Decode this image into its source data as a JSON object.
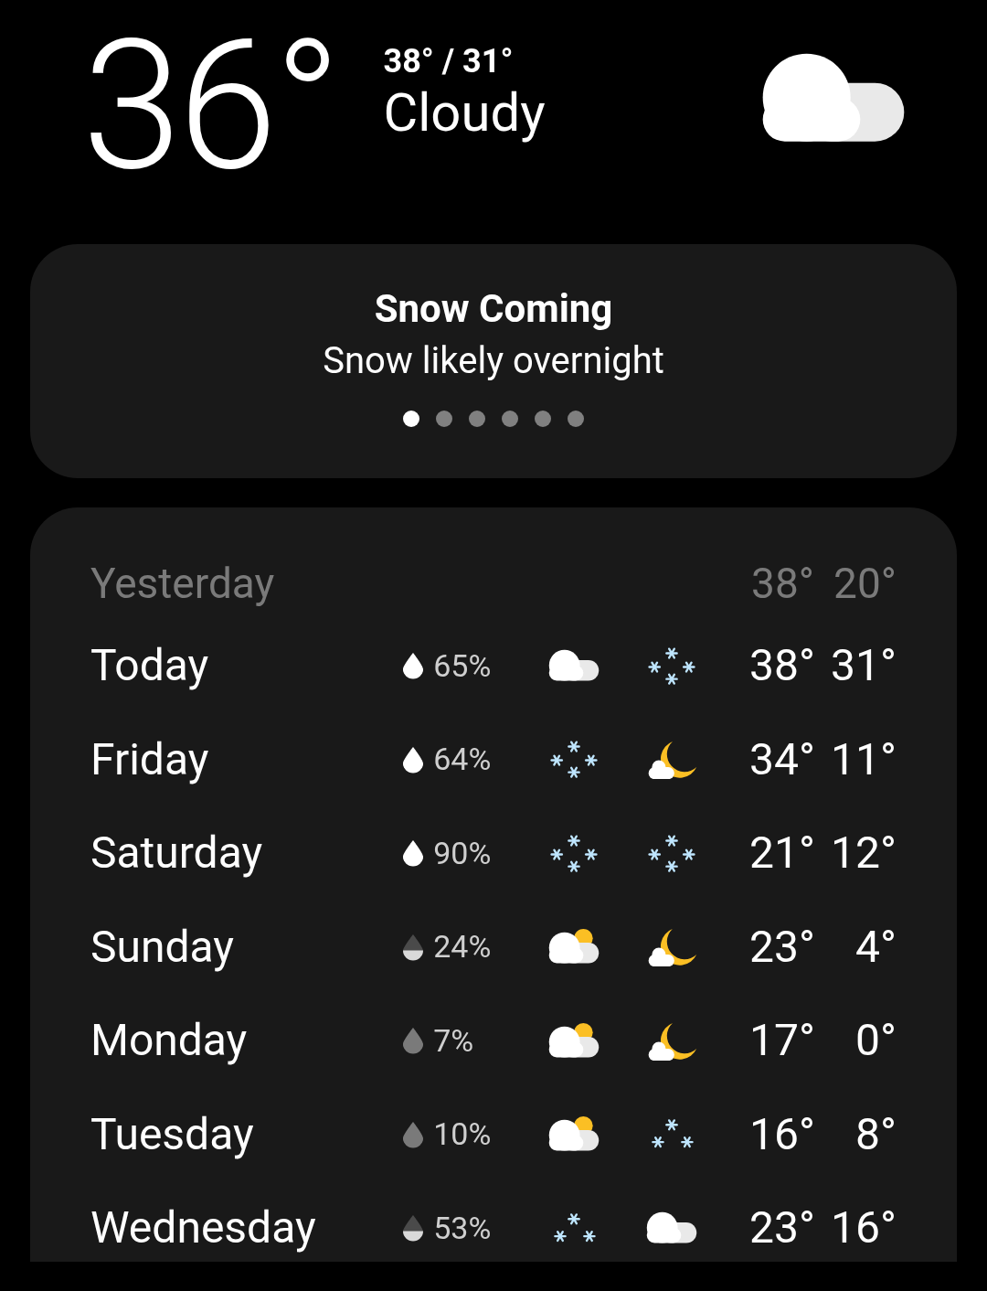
{
  "current": {
    "temperature": "36°",
    "high_low": "38° / 31°",
    "condition": "Cloudy",
    "icon": {
      "kind": "cloudy"
    }
  },
  "alert": {
    "title": "Snow Coming",
    "message": "Snow likely overnight",
    "pages": [
      {
        "selected": true
      },
      {
        "selected": false
      },
      {
        "selected": false
      },
      {
        "selected": false
      },
      {
        "selected": false
      },
      {
        "selected": false
      }
    ]
  },
  "yesterday": {
    "label": "Yesterday",
    "high": "38°",
    "low": "20°"
  },
  "forecast": [
    {
      "day": "Today",
      "drop": {
        "kind": "full"
      },
      "chance": "65%",
      "day_icon": {
        "kind": "cloudy"
      },
      "night_icon": {
        "kind": "snow"
      },
      "high": "38°",
      "low": "31°"
    },
    {
      "day": "Friday",
      "drop": {
        "kind": "full"
      },
      "chance": "64%",
      "day_icon": {
        "kind": "snow"
      },
      "night_icon": {
        "kind": "moon"
      },
      "high": "34°",
      "low": "11°"
    },
    {
      "day": "Saturday",
      "drop": {
        "kind": "full"
      },
      "chance": "90%",
      "day_icon": {
        "kind": "snow"
      },
      "night_icon": {
        "kind": "snow"
      },
      "high": "21°",
      "low": "12°"
    },
    {
      "day": "Sunday",
      "drop": {
        "kind": "half"
      },
      "chance": "24%",
      "day_icon": {
        "kind": "sun"
      },
      "night_icon": {
        "kind": "moon"
      },
      "high": "23°",
      "low": "4°"
    },
    {
      "day": "Monday",
      "drop": {
        "kind": "empty"
      },
      "chance": "7%",
      "day_icon": {
        "kind": "sun"
      },
      "night_icon": {
        "kind": "moon"
      },
      "high": "17°",
      "low": "0°"
    },
    {
      "day": "Tuesday",
      "drop": {
        "kind": "empty"
      },
      "chance": "10%",
      "day_icon": {
        "kind": "sun"
      },
      "night_icon": {
        "kind": "flurries"
      },
      "high": "16°",
      "low": "8°"
    },
    {
      "day": "Wednesday",
      "drop": {
        "kind": "half"
      },
      "chance": "53%",
      "day_icon": {
        "kind": "flurries"
      },
      "night_icon": {
        "kind": "cloudy"
      },
      "high": "23°",
      "low": "16°"
    }
  ]
}
